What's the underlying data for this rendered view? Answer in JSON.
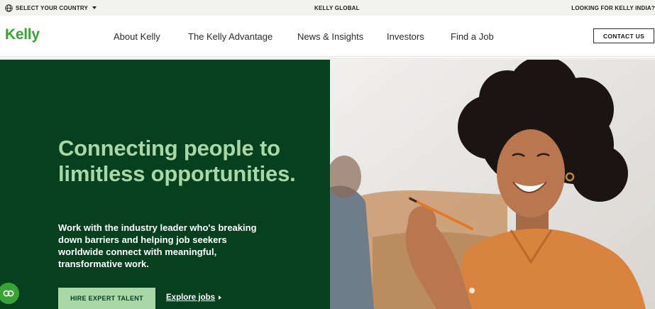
{
  "utility": {
    "country_label": "SELECT YOUR COUNTRY",
    "global_label": "KELLY GLOBAL",
    "india_label": "LOOKING FOR KELLY INDIA?"
  },
  "header": {
    "logo": "Kelly",
    "nav": [
      "About Kelly",
      "The Kelly Advantage",
      "News & Insights",
      "Investors",
      "Find a Job"
    ],
    "contact_label": "CONTACT US"
  },
  "hero": {
    "title": "Connecting people to limitless opportunities.",
    "subtitle": "Work with the industry leader who's breaking down barriers and helping job seekers worldwide connect with meaningful, transformative work.",
    "hire_label": "HIRE EXPERT TALENT",
    "explore_label": "Explore jobs"
  },
  "colors": {
    "brand_green": "#3aa335",
    "hero_dark_green": "#06401f",
    "hero_light_green": "#a9d8a6"
  },
  "icons": {
    "globe": "globe-icon",
    "caret": "caret-down-icon",
    "explore": "triangle-right-icon",
    "chat": "chat-icon"
  }
}
